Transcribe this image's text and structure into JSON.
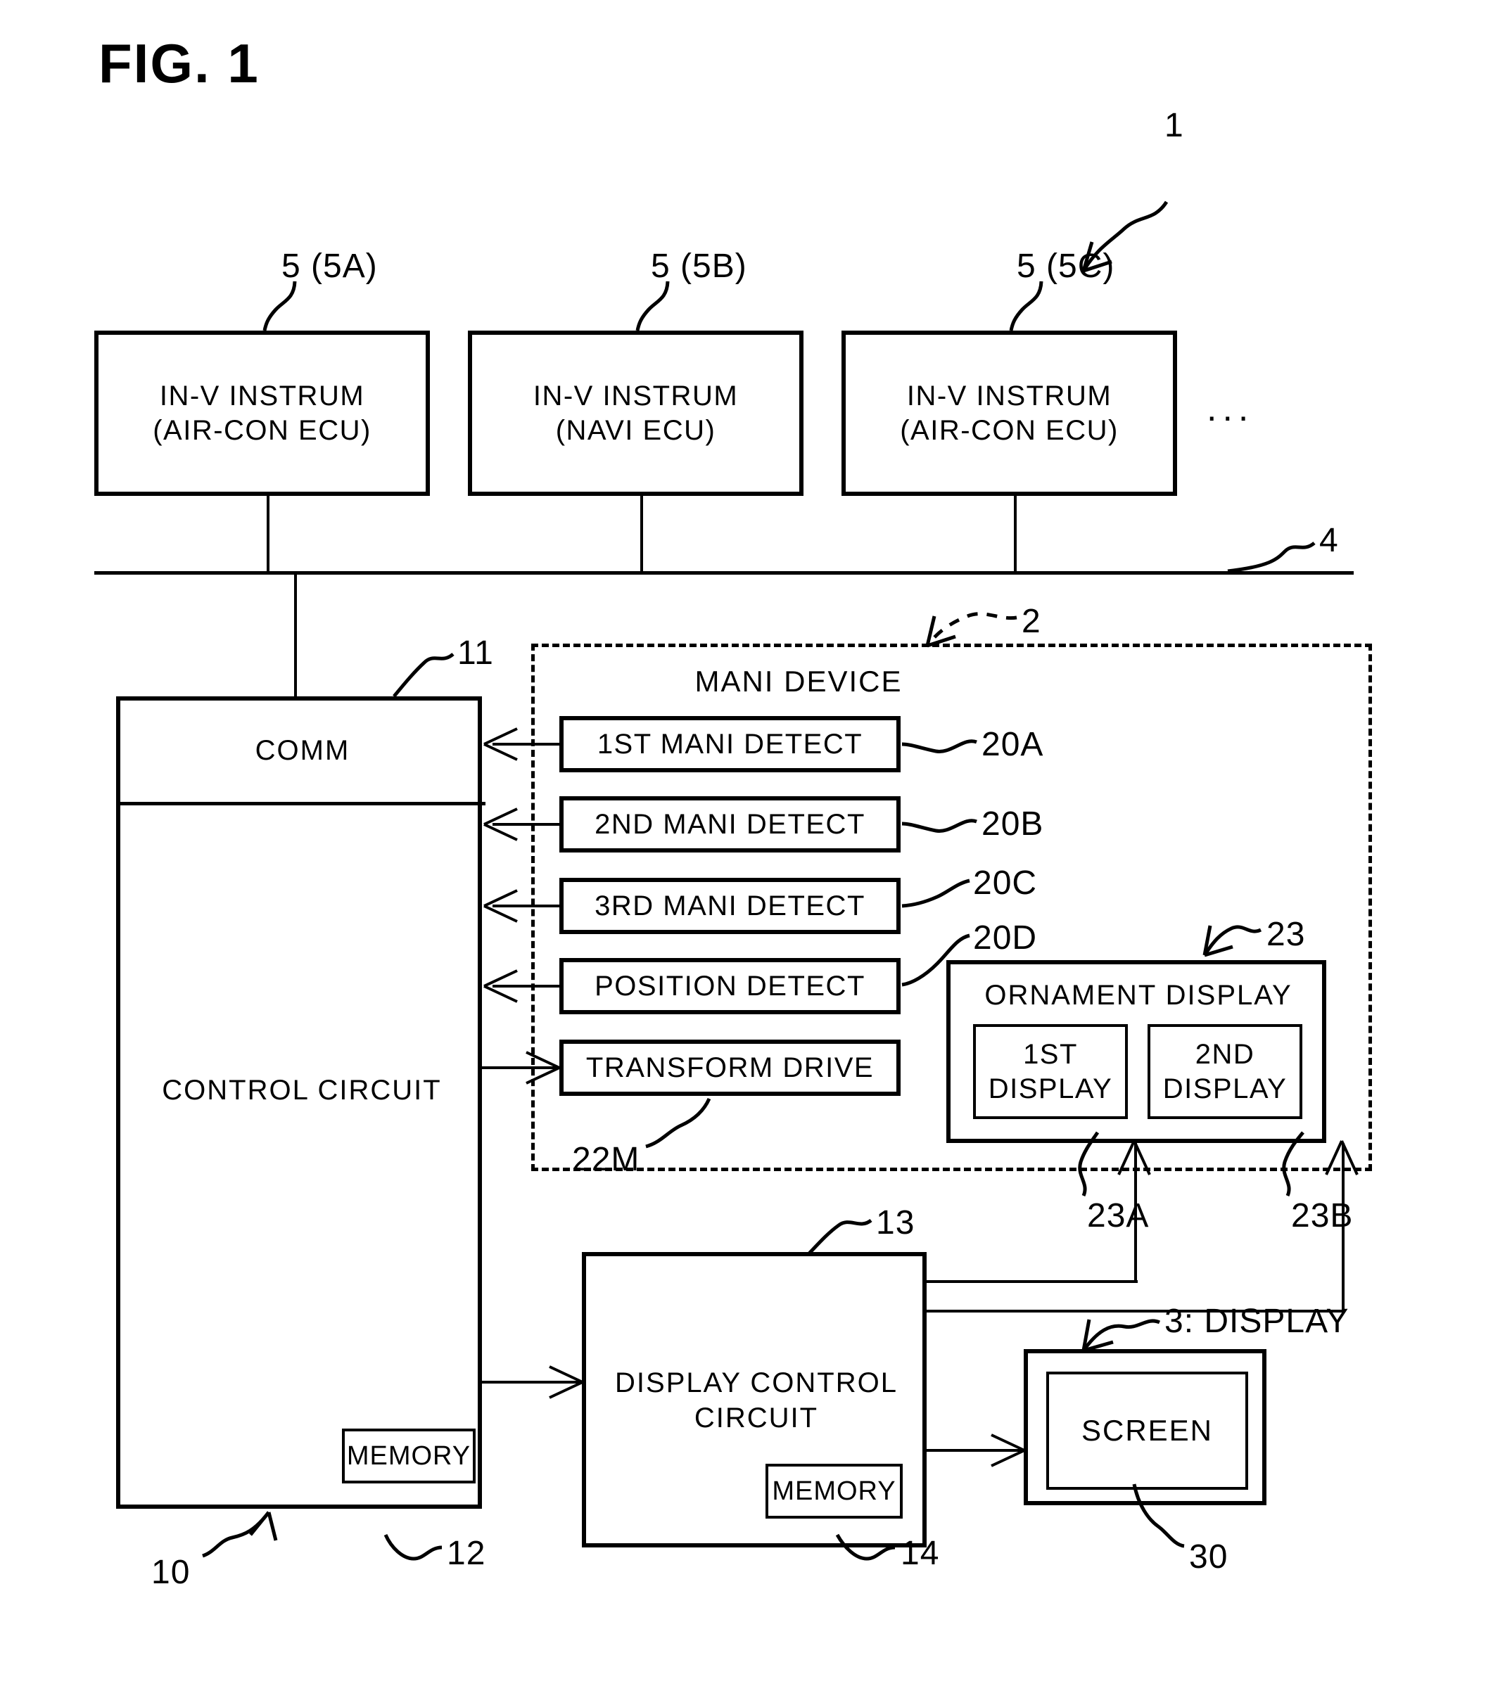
{
  "figure": {
    "title": "FIG. 1",
    "system_ref": "1",
    "bus_ref": "4",
    "ellipsis": "..."
  },
  "instruments": {
    "items": [
      {
        "ref": "5 (5A)",
        "line1": "IN-V INSTRUM",
        "line2": "(AIR-CON ECU)"
      },
      {
        "ref": "5 (5B)",
        "line1": "IN-V INSTRUM",
        "line2": "(NAVI ECU)"
      },
      {
        "ref": "5 (5C)",
        "line1": "IN-V INSTRUM",
        "line2": "(AIR-CON ECU)"
      }
    ]
  },
  "ecu": {
    "ref": "10",
    "comm": {
      "label": "COMM",
      "ref": "11"
    },
    "control": {
      "label": "CONTROL CIRCUIT"
    },
    "memory": {
      "label": "MEMORY",
      "ref": "12"
    }
  },
  "mani_device": {
    "ref": "2",
    "title": "MANI DEVICE",
    "blocks": [
      {
        "label": "1ST MANI DETECT",
        "ref": "20A"
      },
      {
        "label": "2ND MANI DETECT",
        "ref": "20B"
      },
      {
        "label": "3RD MANI DETECT",
        "ref": "20C"
      },
      {
        "label": "POSITION DETECT",
        "ref": "20D"
      },
      {
        "label": "TRANSFORM DRIVE",
        "ref": "22M"
      }
    ],
    "ornament_display": {
      "ref": "23",
      "title": "ORNAMENT DISPLAY",
      "panels": [
        {
          "line1": "1ST",
          "line2": "DISPLAY",
          "ref": "23A"
        },
        {
          "line1": "2ND",
          "line2": "DISPLAY",
          "ref": "23B"
        }
      ]
    }
  },
  "display_control": {
    "line1": "DISPLAY CONTROL",
    "line2": "CIRCUIT",
    "ref": "13",
    "memory": {
      "label": "MEMORY",
      "ref": "14"
    }
  },
  "display": {
    "ref": "3: DISPLAY",
    "screen": {
      "label": "SCREEN",
      "ref": "30"
    }
  }
}
